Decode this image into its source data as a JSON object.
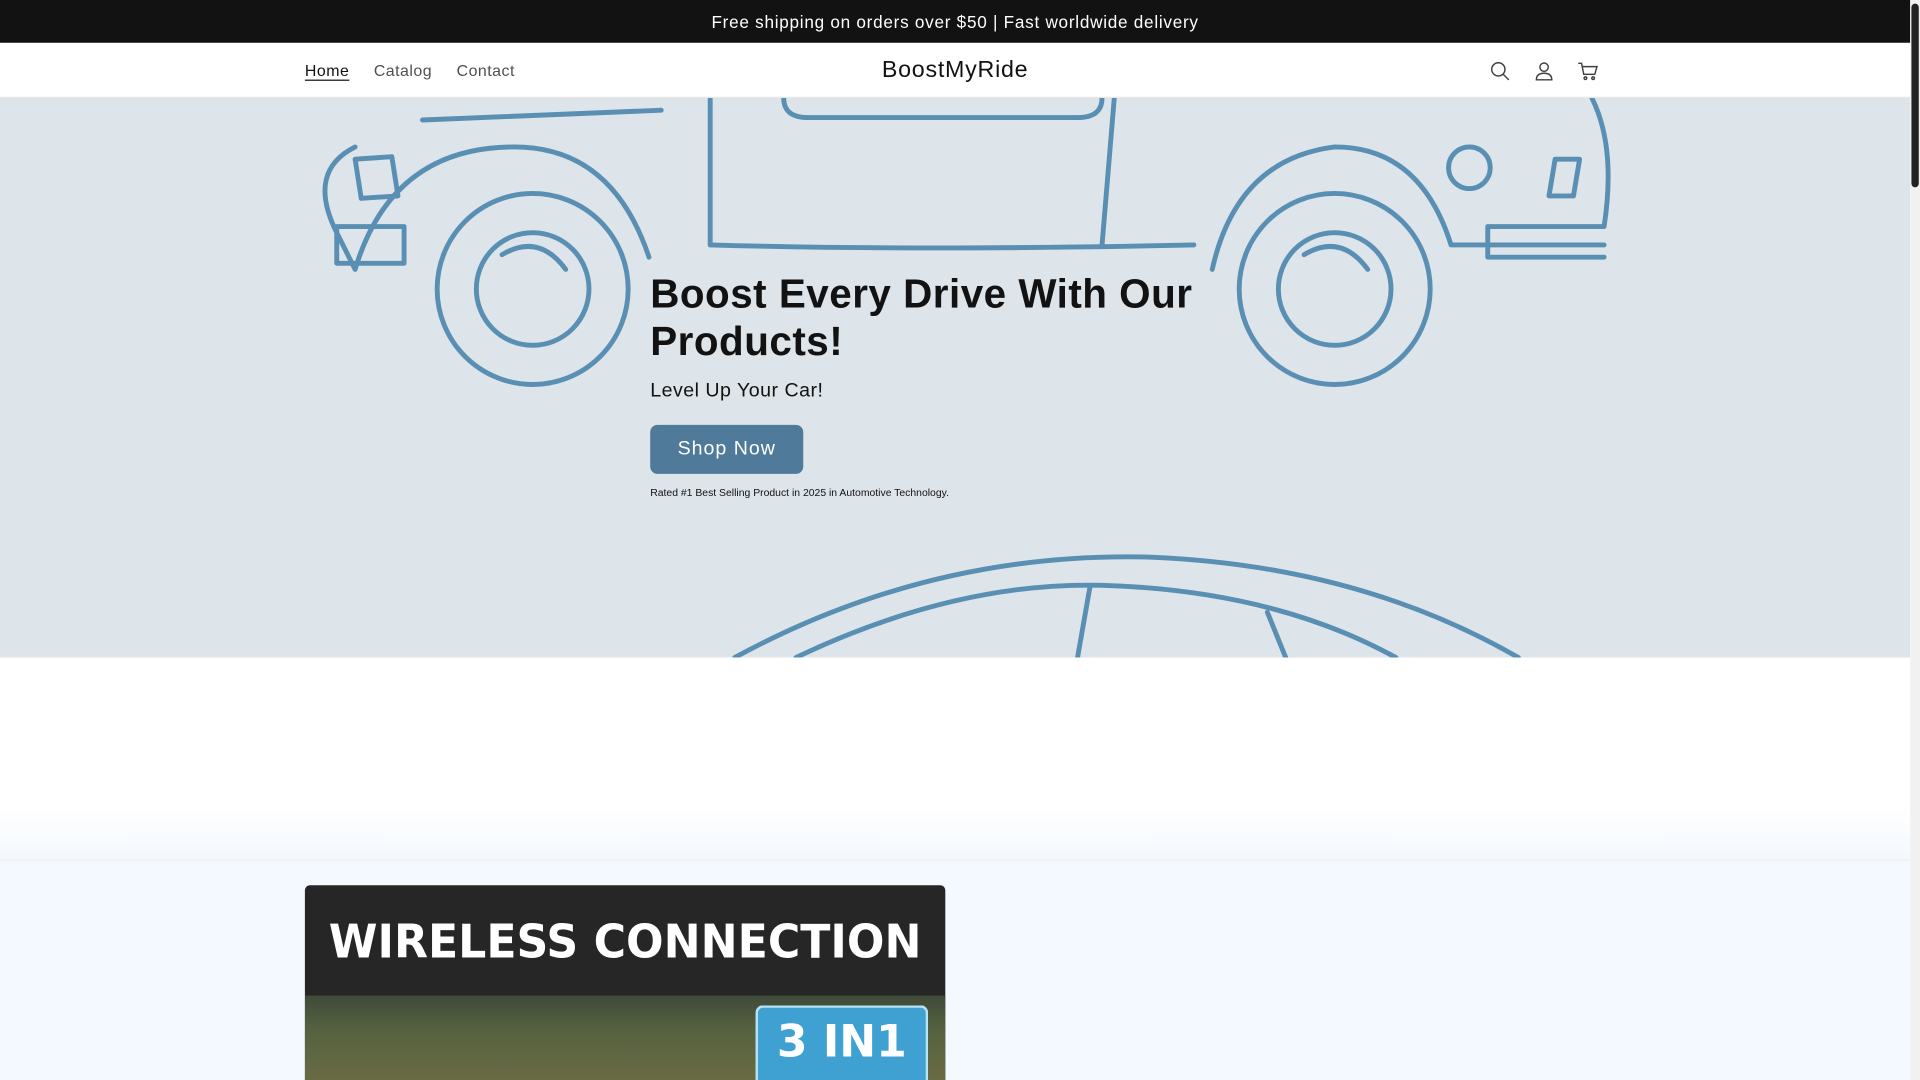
{
  "announcement": {
    "text": "Free shipping on orders over $50 | Fast worldwide delivery"
  },
  "header": {
    "nav": [
      {
        "label": "Home",
        "active": true
      },
      {
        "label": "Catalog",
        "active": false
      },
      {
        "label": "Contact",
        "active": false
      }
    ],
    "logo": "BoostMyRide",
    "icons": [
      "search-icon",
      "account-icon",
      "cart-icon"
    ]
  },
  "hero": {
    "title": "Boost Every Drive With Our Products!",
    "subtitle": "Level Up Your Car!",
    "button_label": "Shop Now",
    "note": "Rated #1 Best Selling Product in 2025 in Automotive Technology."
  },
  "feature": {
    "image_headline": "WIRELESS CONNECTION",
    "image_badge": "3 IN1"
  },
  "colors": {
    "announcement_bg": "#121212",
    "hero_bg": "#dde4ea",
    "button_bg": "#4f7a99",
    "line_art": "#5a8fb4",
    "badge_bg": "#3fa1d2"
  }
}
